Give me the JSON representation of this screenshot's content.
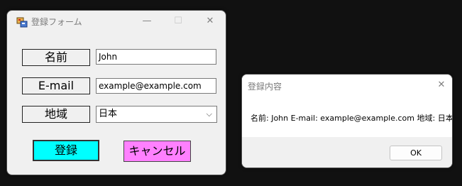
{
  "form_window": {
    "title": "登録フォーム",
    "min_glyph": "—",
    "max_glyph": "☐",
    "close_glyph": "✕",
    "name_label": "名前",
    "name_value": "John",
    "email_label": "E-mail",
    "email_value": "example@example.com",
    "region_label": "地域",
    "region_value": "日本",
    "chevron_glyph": "⌵",
    "register_label": "登録",
    "cancel_label": "キャンセル"
  },
  "dialog_window": {
    "title": "登録内容",
    "close_glyph": "✕",
    "message": "名前: John E-mail: example@example.com 地域: 日本",
    "ok_label": "OK"
  },
  "colors": {
    "register_button": "#00ffff",
    "cancel_button": "#ff80ff",
    "background": "#111111"
  },
  "icons": {
    "app_icon": "windows-form-icon"
  }
}
